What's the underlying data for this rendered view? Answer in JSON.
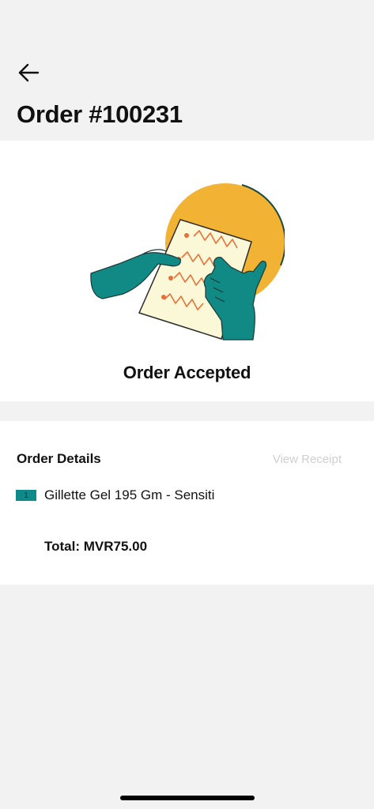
{
  "header": {
    "title": "Order #100231"
  },
  "hero": {
    "status": "Order Accepted"
  },
  "details": {
    "title": "Order Details",
    "view_receipt_label": "View Receipt",
    "items": [
      {
        "qty": "1",
        "name": "Gillette Gel 195 Gm - Sensiti"
      }
    ],
    "total_label": "Total: MVR75.00"
  },
  "colors": {
    "accent_teal": "#0f8a8a",
    "sun_yellow": "#f2b233",
    "muted_link": "#cfcfcf"
  },
  "icons": {
    "back": "arrow-left-icon"
  }
}
